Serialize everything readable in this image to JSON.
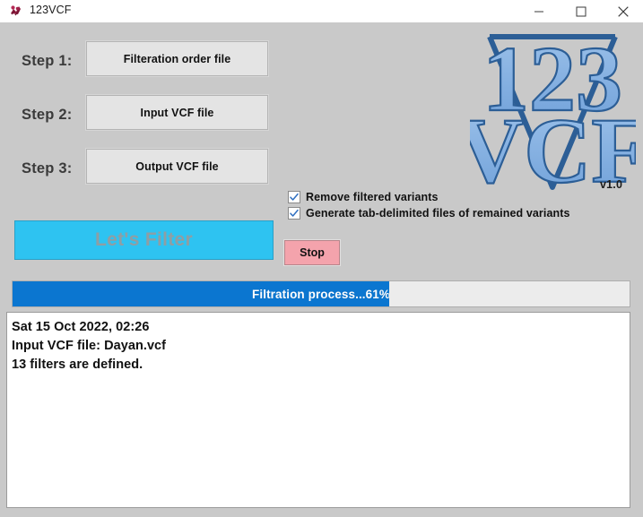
{
  "window": {
    "title": "123VCF",
    "icon": "app-icon",
    "controls": {
      "minimize": "minimize-icon",
      "maximize": "maximize-icon",
      "close": "close-icon"
    }
  },
  "steps": [
    {
      "label": "Step 1:",
      "button": "Filteration order file"
    },
    {
      "label": "Step 2:",
      "button": "Input VCF file"
    },
    {
      "label": "Step 3:",
      "button": "Output VCF file"
    }
  ],
  "logo": {
    "top_text": "123",
    "bottom_text": "VCF",
    "version": "v1.0",
    "fill_color": "#7aa9de",
    "outline_color": "#2c5e96"
  },
  "options": [
    {
      "label": "Remove filtered variants",
      "checked": true
    },
    {
      "label": "Generate tab-delimited files of remained variants",
      "checked": true
    }
  ],
  "actions": {
    "run_label": "Let's Filter",
    "run_color": "#2ec3f1",
    "run_text_color": "#8f9ea4",
    "stop_label": "Stop",
    "stop_color": "#f4a3ac"
  },
  "progress": {
    "text": "Filtration process...61%",
    "percent": 61,
    "fill_color": "#0b76d0",
    "track_color": "#ececec"
  },
  "log": {
    "lines": [
      "Sat 15 Oct 2022, 02:26",
      "Input VCF file: Dayan.vcf",
      "13 filters are defined."
    ]
  }
}
